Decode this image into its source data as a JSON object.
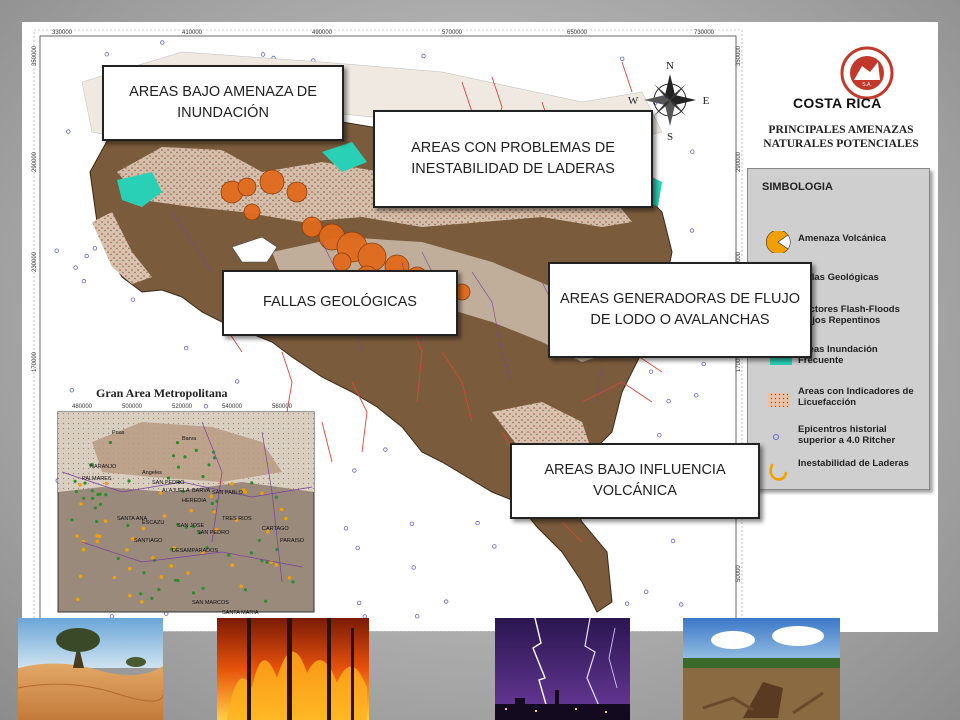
{
  "map": {
    "country": "COSTA RICA",
    "subtitle_line1": "PRINCIPALES AMENAZAS",
    "subtitle_line2": "NATURALES POTENCIALES",
    "logo_text": "S.A.",
    "compass": {
      "north": "N",
      "south": "S",
      "east": "E",
      "west": "W"
    },
    "top_coords": [
      "330000",
      "410000",
      "490000",
      "570000",
      "650000",
      "730000"
    ],
    "left_coords": [
      "350000",
      "290000",
      "230000",
      "170000"
    ],
    "right_coords": [
      "350000",
      "290000",
      "230000",
      "170000",
      "110000",
      "50000"
    ],
    "inset": {
      "title": "Gran Area Metropolitana",
      "top_coords": [
        "480000",
        "500000",
        "520000",
        "540000",
        "560000"
      ],
      "place_names": [
        "Poas",
        "Barva",
        "NARANJO",
        "Angeles",
        "PALMARES",
        "SAN PEDRO",
        "ALAJUELA",
        "BARVA",
        "SAN PABLO",
        "HEREDIA",
        "SANTA ANA",
        "ESCAZU",
        "SAN JOSE",
        "SAN PEDRO",
        "TRES RIOS",
        "CARTAGO",
        "PARAISO",
        "SANTIAGO",
        "DESAMPARADOS",
        "SAN MARCOS",
        "SANTA MARIA"
      ]
    }
  },
  "legend": {
    "title": "SIMBOLOGIA",
    "items": [
      {
        "label": "Amenaza Volcánica",
        "icon": "volcano-sector-icon",
        "color": "#f0a000"
      },
      {
        "label": "Fallas Geológicas",
        "icon": "fault-line-icon",
        "color": "#c0392b"
      },
      {
        "label": "Sectores Flash-Floods Flujos Repentinos",
        "icon": "flash-flood-icon",
        "color": "#7b3fa0"
      },
      {
        "label": "Areas Inundación Frecuente",
        "icon": "flood-area-icon",
        "color": "#2ad0b5"
      },
      {
        "label": "Areas con Indicadores de Licuefacción",
        "icon": "liquefaction-icon",
        "color": "#e8c3a8"
      },
      {
        "label": "Epicentros historial superior a 4.0 Ritcher",
        "icon": "epicenter-icon",
        "color": "#6666cc"
      },
      {
        "label": "Inestabilidad de Laderas",
        "icon": "slope-instability-icon",
        "color": "#f0a000"
      }
    ]
  },
  "callouts": {
    "flood": "AREAS BAJO AMENAZA DE INUNDACIÓN",
    "landslide": "AREAS CON PROBLEMAS DE INESTABILIDAD DE LADERAS",
    "faults": "FALLAS GEOLÓGICAS",
    "mudflow": "AREAS GENERADORAS DE FLUJO DE LODO O AVALANCHAS",
    "volcanic": "AREAS BAJO INFLUENCIA VOLCÁNICA"
  },
  "colors": {
    "terrain": "#7a5c3c",
    "highland": "#c9b7a4",
    "water": "#2ad0b5",
    "volcano": "#e06a1c",
    "fault": "#d9453a"
  },
  "photos": [
    "desert-photo",
    "wildfire-photo",
    "lightning-photo",
    "deforestation-photo"
  ]
}
